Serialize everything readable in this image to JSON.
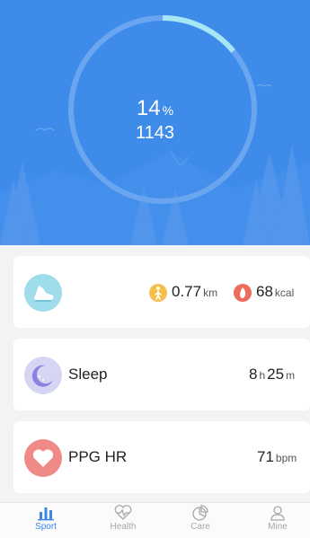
{
  "hero": {
    "progress_fraction": 0.14,
    "percent_value": "14",
    "percent_unit": "%",
    "steps": "1143",
    "colors": {
      "background": "#3e8bea",
      "ring_track": "#6aa6f0",
      "ring_fill": "#a6e6f5"
    }
  },
  "cards": {
    "steps": {
      "icon": "shoe-icon",
      "distance_value": "0.77",
      "distance_unit": "km",
      "calories_value": "68",
      "calories_unit": "kcal"
    },
    "sleep": {
      "icon": "moon-icon",
      "title": "Sleep",
      "hours": "8",
      "hours_unit": "h",
      "minutes": "25",
      "minutes_unit": "m"
    },
    "heart": {
      "icon": "heart-icon",
      "title": "PPG HR",
      "value": "71",
      "unit": "bpm"
    }
  },
  "nav": {
    "items": [
      {
        "label": "Sport",
        "icon": "bar-chart-icon",
        "active": true
      },
      {
        "label": "Health",
        "icon": "heart-pulse-icon",
        "active": false
      },
      {
        "label": "Care",
        "icon": "pie-chart-icon",
        "active": false
      },
      {
        "label": "Mine",
        "icon": "person-icon",
        "active": false
      }
    ]
  }
}
